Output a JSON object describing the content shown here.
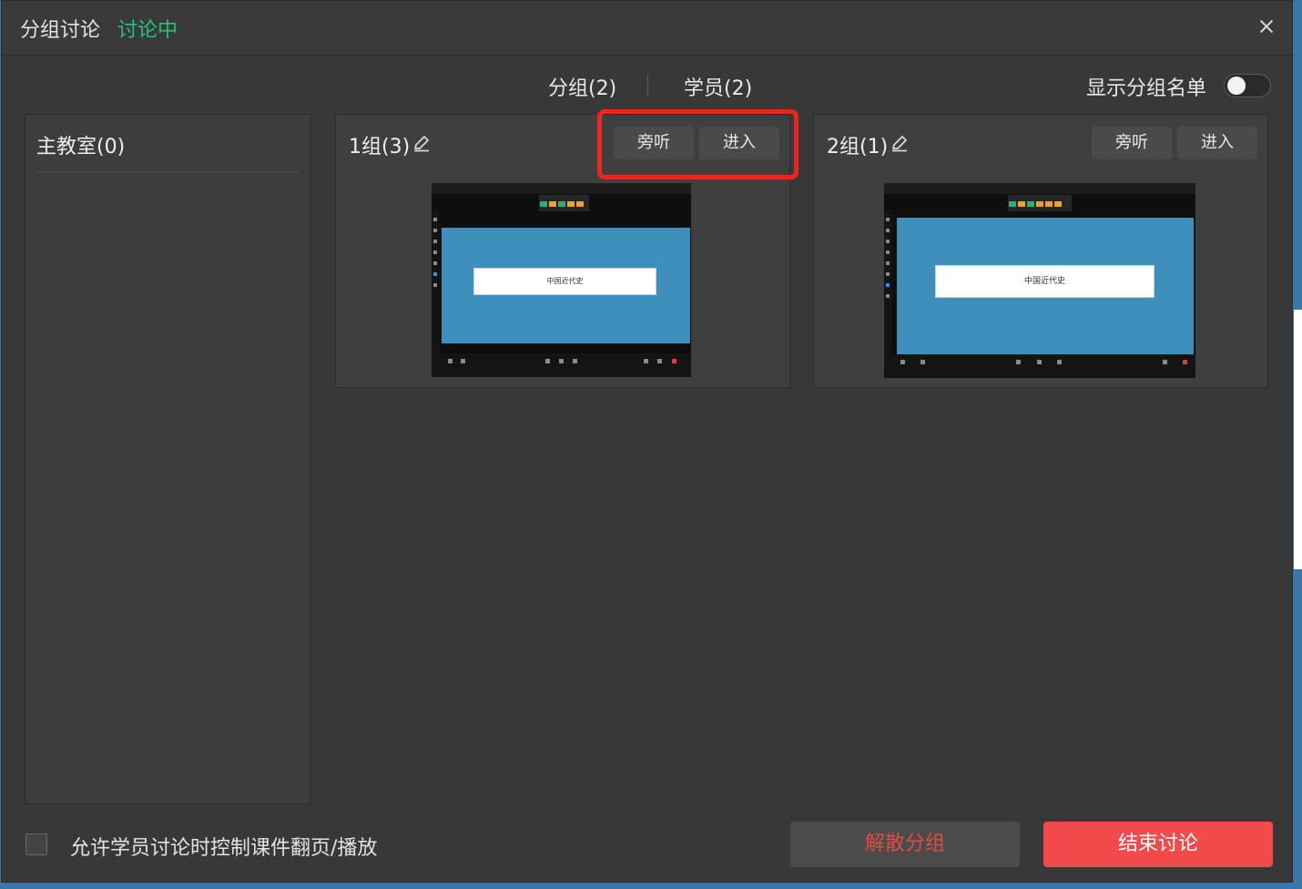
{
  "dialog": {
    "title": "分组讨论",
    "status": "讨论中",
    "status_color": "#22c47c",
    "close_icon": "close-icon"
  },
  "tabs": [
    {
      "label": "分组(2)"
    },
    {
      "label": "学员(2)"
    }
  ],
  "roster_toggle": {
    "label": "显示分组名单",
    "on": false
  },
  "main_room": {
    "title": "主教室(0)"
  },
  "groups": [
    {
      "name": "1组(3)",
      "listen_label": "旁听",
      "enter_label": "进入",
      "preview_text": "中国近代史",
      "highlighted": true
    },
    {
      "name": "2组(1)",
      "listen_label": "旁听",
      "enter_label": "进入",
      "preview_text": "中国近代史",
      "highlighted": false
    }
  ],
  "footer": {
    "allow_control_label": "允许学员讨论时控制课件翻页/播放",
    "allow_control_checked": false,
    "dissolve_label": "解散分组",
    "end_label": "结束讨论"
  },
  "colors": {
    "accent_green": "#22c47c",
    "danger_red": "#f24a4a",
    "highlight_red": "#e8281e"
  }
}
